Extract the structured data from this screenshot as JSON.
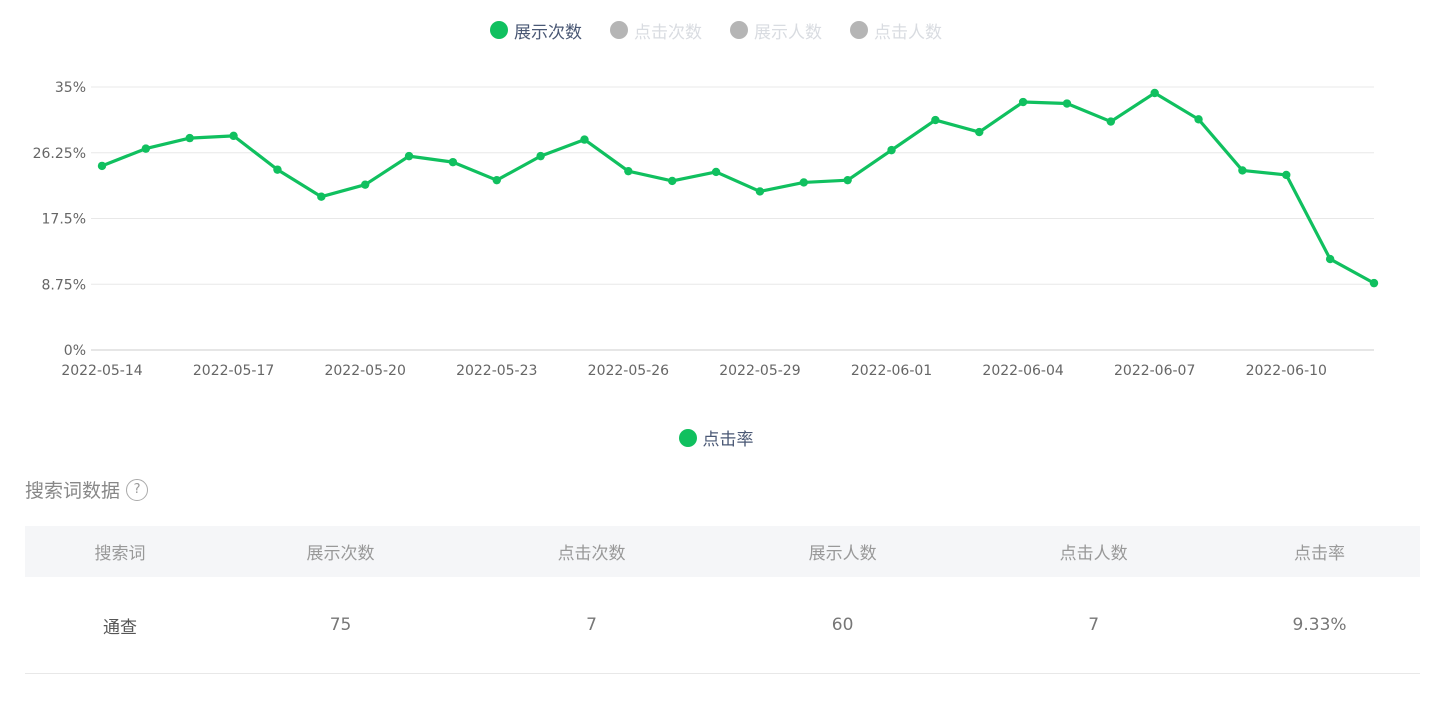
{
  "legend_top": [
    {
      "label": "展示次数",
      "active": true,
      "color": "#10c05f"
    },
    {
      "label": "点击次数",
      "active": false,
      "color": "#b5b5b5"
    },
    {
      "label": "展示人数",
      "active": false,
      "color": "#b5b5b5"
    },
    {
      "label": "点击人数",
      "active": false,
      "color": "#b5b5b5"
    }
  ],
  "chart_data": {
    "type": "line",
    "series": [
      {
        "name": "点击率",
        "color": "#10c05f",
        "values": [
          24.5,
          26.8,
          28.2,
          28.5,
          24.0,
          20.4,
          22.0,
          25.8,
          25.0,
          22.6,
          25.8,
          28.0,
          23.8,
          22.5,
          23.7,
          21.1,
          22.3,
          22.6,
          26.6,
          30.6,
          29.0,
          33.0,
          32.8,
          30.4,
          34.2,
          30.7,
          23.9,
          23.3,
          12.1,
          8.9
        ]
      }
    ],
    "x": [
      "2022-05-14",
      "2022-05-15",
      "2022-05-16",
      "2022-05-17",
      "2022-05-18",
      "2022-05-19",
      "2022-05-20",
      "2022-05-21",
      "2022-05-22",
      "2022-05-23",
      "2022-05-24",
      "2022-05-25",
      "2022-05-26",
      "2022-05-27",
      "2022-05-28",
      "2022-05-29",
      "2022-05-30",
      "2022-05-31",
      "2022-06-01",
      "2022-06-02",
      "2022-06-03",
      "2022-06-04",
      "2022-06-05",
      "2022-06-06",
      "2022-06-07",
      "2022-06-08",
      "2022-06-09",
      "2022-06-10",
      "2022-06-11",
      "2022-06-12"
    ],
    "x_tick_labels": [
      "2022-05-14",
      "2022-05-17",
      "2022-05-20",
      "2022-05-23",
      "2022-05-26",
      "2022-05-29",
      "2022-06-01",
      "2022-06-04",
      "2022-06-07",
      "2022-06-10"
    ],
    "y_ticks": [
      0,
      8.75,
      17.5,
      26.25,
      35
    ],
    "y_tick_labels": [
      "0%",
      "8.75%",
      "17.5%",
      "26.25%",
      "35%"
    ],
    "ylim": [
      0,
      35
    ],
    "grid": true,
    "legend": "bottom-center"
  },
  "legend_bottom": {
    "label": "点击率",
    "color": "#10c05f"
  },
  "section": {
    "title": "搜索词数据",
    "help": "?"
  },
  "table": {
    "headers": [
      "搜索词",
      "展示次数",
      "点击次数",
      "展示人数",
      "点击人数",
      "点击率"
    ],
    "rows": [
      [
        "通查",
        "75",
        "7",
        "60",
        "7",
        "9.33%"
      ]
    ]
  }
}
